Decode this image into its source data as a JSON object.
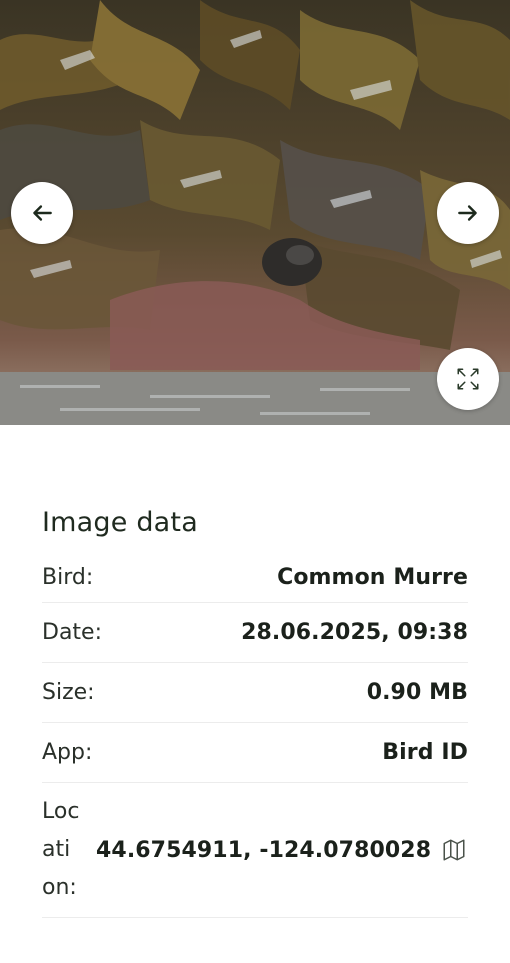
{
  "gallery": {
    "prev_icon": "arrow-left-icon",
    "next_icon": "arrow-right-icon",
    "fullscreen_icon": "expand-icon",
    "image_alt": "Bird photo among kelp at waterline"
  },
  "details": {
    "title": "Image data",
    "rows": [
      {
        "label": "Bird:",
        "value": "Common Murre"
      },
      {
        "label": "Date:",
        "value": "28.06.2025, 09:38"
      },
      {
        "label": "Size:",
        "value": "0.90 MB"
      },
      {
        "label": "App:",
        "value": "Bird ID"
      }
    ],
    "location": {
      "label": "Location:",
      "value": "44.6754911, -124.0780028",
      "icon": "map-icon"
    }
  }
}
